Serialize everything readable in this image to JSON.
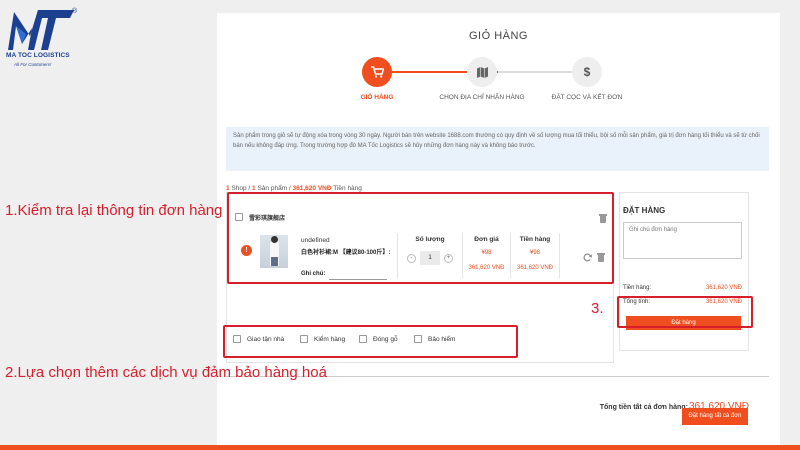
{
  "logo": {
    "brand": "MA TOC LOGISTICS",
    "tagline": "All For Customers!",
    "registered": "®"
  },
  "header": {
    "title": "GIỎ HÀNG"
  },
  "steps": [
    {
      "label": "GIỎ HÀNG",
      "icon": "cart-icon",
      "active": true
    },
    {
      "label": "CHỌN ĐỊA CHỈ NHẬN HÀNG",
      "icon": "map-icon",
      "active": false
    },
    {
      "label": "ĐẶT CỌC VÀ KẾT ĐƠN",
      "icon": "dollar-icon",
      "active": false
    }
  ],
  "notice": "Sản phẩm trong giỏ sẽ tự động xóa trong vòng 30 ngày. Người bán trên website 1688.com thường có quy định về số lượng mua tối thiểu, bội số mỗi sản phẩm, giá trị đơn hàng tối thiểu và sẽ từ chối bán nếu không đáp ứng. Trong trường hợp đó MA Tốc Logistics sẽ hủy những đơn hàng này và không báo trước.",
  "summary": {
    "shops": "1",
    "shops_label": " Shop / ",
    "products": "1",
    "products_label": " Sản phẩm / ",
    "amount": "361,620 VNĐ",
    "amount_label": " Tiền hàng"
  },
  "shop": {
    "name": "雪彩琪旗舰店",
    "item": {
      "alert": "!",
      "name": "undefined",
      "attributes": "白色衬衫裙:M 【建议80-100斤】:",
      "note_label": "Ghi chú:",
      "qty_header": "Số lượng",
      "qty": "1",
      "minus": "-",
      "plus": "+",
      "unit_header": "Đơn giá",
      "unit_cny": "¥98",
      "unit_vnd": "361,620 VNĐ",
      "total_header": "Tiền hàng",
      "total_cny": "¥98",
      "total_vnd": "361,620 VNĐ"
    }
  },
  "services": [
    "Giao tận nhà",
    "Kiểm hàng",
    "Đóng gỗ",
    "Bảo hiểm"
  ],
  "order": {
    "title": "ĐẶT HÀNG",
    "note_placeholder": "Ghi chú đơn hàng",
    "goods_label": "Tiền hàng:",
    "goods_value": "361,620 VNĐ",
    "total_label": "Tổng tính:",
    "total_value": "361,620 VNĐ",
    "button": "Đặt hàng"
  },
  "grand_total": {
    "label": "Tổng tiền tất cả đơn hàng:",
    "value": "361,620 VNĐ",
    "button": "Đặt hàng tất cả đơn"
  },
  "annotations": {
    "a1": "1.Kiểm tra lại thông tin đơn hàng",
    "a2": "2.Lựa chọn thêm các dịch vụ đảm bảo hàng hoá",
    "a3": "3."
  },
  "colors": {
    "accent": "#f04e1e",
    "annotation": "#d71f2c",
    "brand": "#1c3f8f",
    "step_inactive": "#eeeeee"
  }
}
